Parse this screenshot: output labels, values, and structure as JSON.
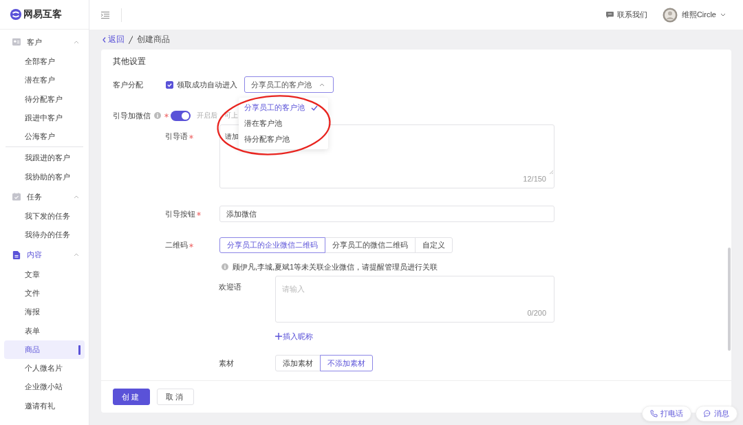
{
  "app": {
    "logo": "网易互客"
  },
  "sidebar": {
    "groups": [
      {
        "kind": "contacts",
        "label": "客户",
        "expanded": true,
        "sections": [
          [
            {
              "label": "全部客户",
              "selected": false
            },
            {
              "label": "潜在客户",
              "selected": false
            },
            {
              "label": "待分配客户",
              "selected": false
            },
            {
              "label": "跟进中客户",
              "selected": false
            },
            {
              "label": "公海客户",
              "selected": false
            }
          ],
          [
            {
              "label": "我跟进的客户",
              "selected": false
            },
            {
              "label": "我协助的客户",
              "selected": false
            }
          ]
        ]
      },
      {
        "kind": "tasks",
        "label": "任务",
        "expanded": true,
        "sections": [
          [
            {
              "label": "我下发的任务",
              "selected": false
            },
            {
              "label": "我待办的任务",
              "selected": false
            }
          ]
        ]
      },
      {
        "kind": "content",
        "label": "内容",
        "expanded": true,
        "sections": [
          [
            {
              "label": "文章",
              "selected": false
            },
            {
              "label": "文件",
              "selected": false
            },
            {
              "label": "海报",
              "selected": false
            },
            {
              "label": "表单",
              "selected": false
            },
            {
              "label": "商品",
              "selected": true
            },
            {
              "label": "个人微名片",
              "selected": false
            },
            {
              "label": "企业微小站",
              "selected": false
            },
            {
              "label": "邀请有礼",
              "selected": false
            }
          ]
        ]
      }
    ]
  },
  "header": {
    "contact": "联系我们",
    "user": "维熙Circle"
  },
  "breadcrumb": {
    "back": "返回",
    "current": "创建商品"
  },
  "form": {
    "section_title": "其他设置",
    "customer_assignment": {
      "label": "客户分配",
      "checkbox": {
        "label": "领取成功自动进入",
        "checked": true
      },
      "select": {
        "value": "分享员工的客户池",
        "open": true,
        "options": [
          {
            "label": "分享员工的客户池",
            "selected": true
          },
          {
            "label": "潜在客户池",
            "selected": false
          },
          {
            "label": "待分配客户池",
            "selected": false
          }
        ]
      }
    },
    "guide_wechat": {
      "label": "引导加微信",
      "required": true,
      "on": true,
      "hint": "开启后，可上"
    },
    "guide_text": {
      "label": "引导语",
      "required": true,
      "value": "请加",
      "counter": "12/150"
    },
    "guide_button": {
      "label": "引导按钮",
      "required": true,
      "value": "添加微信"
    },
    "qr_code": {
      "label": "二维码",
      "required": true,
      "options": [
        {
          "label": "分享员工的企业微信二维码",
          "selected": true
        },
        {
          "label": "分享员工的微信二维码",
          "selected": false
        },
        {
          "label": "自定义",
          "selected": false
        }
      ],
      "notice": "顾伊凡,李城,夏斌1等未关联企业微信，请提醒管理员进行关联"
    },
    "welcome": {
      "label": "欢迎语",
      "placeholder": "请输入",
      "counter": "0/200"
    },
    "insert_nickname": "插入昵称",
    "material": {
      "label": "素材",
      "options": [
        {
          "label": "添加素材",
          "selected": false
        },
        {
          "label": "不添加素材",
          "selected": true
        }
      ]
    }
  },
  "footer": {
    "buttons": [
      {
        "label": "创建",
        "kind": "primary"
      },
      {
        "label": "取消",
        "kind": "default"
      }
    ]
  },
  "floating": [
    {
      "label": "打电话",
      "kind": "phone"
    },
    {
      "label": "消息",
      "kind": "chat"
    }
  ]
}
